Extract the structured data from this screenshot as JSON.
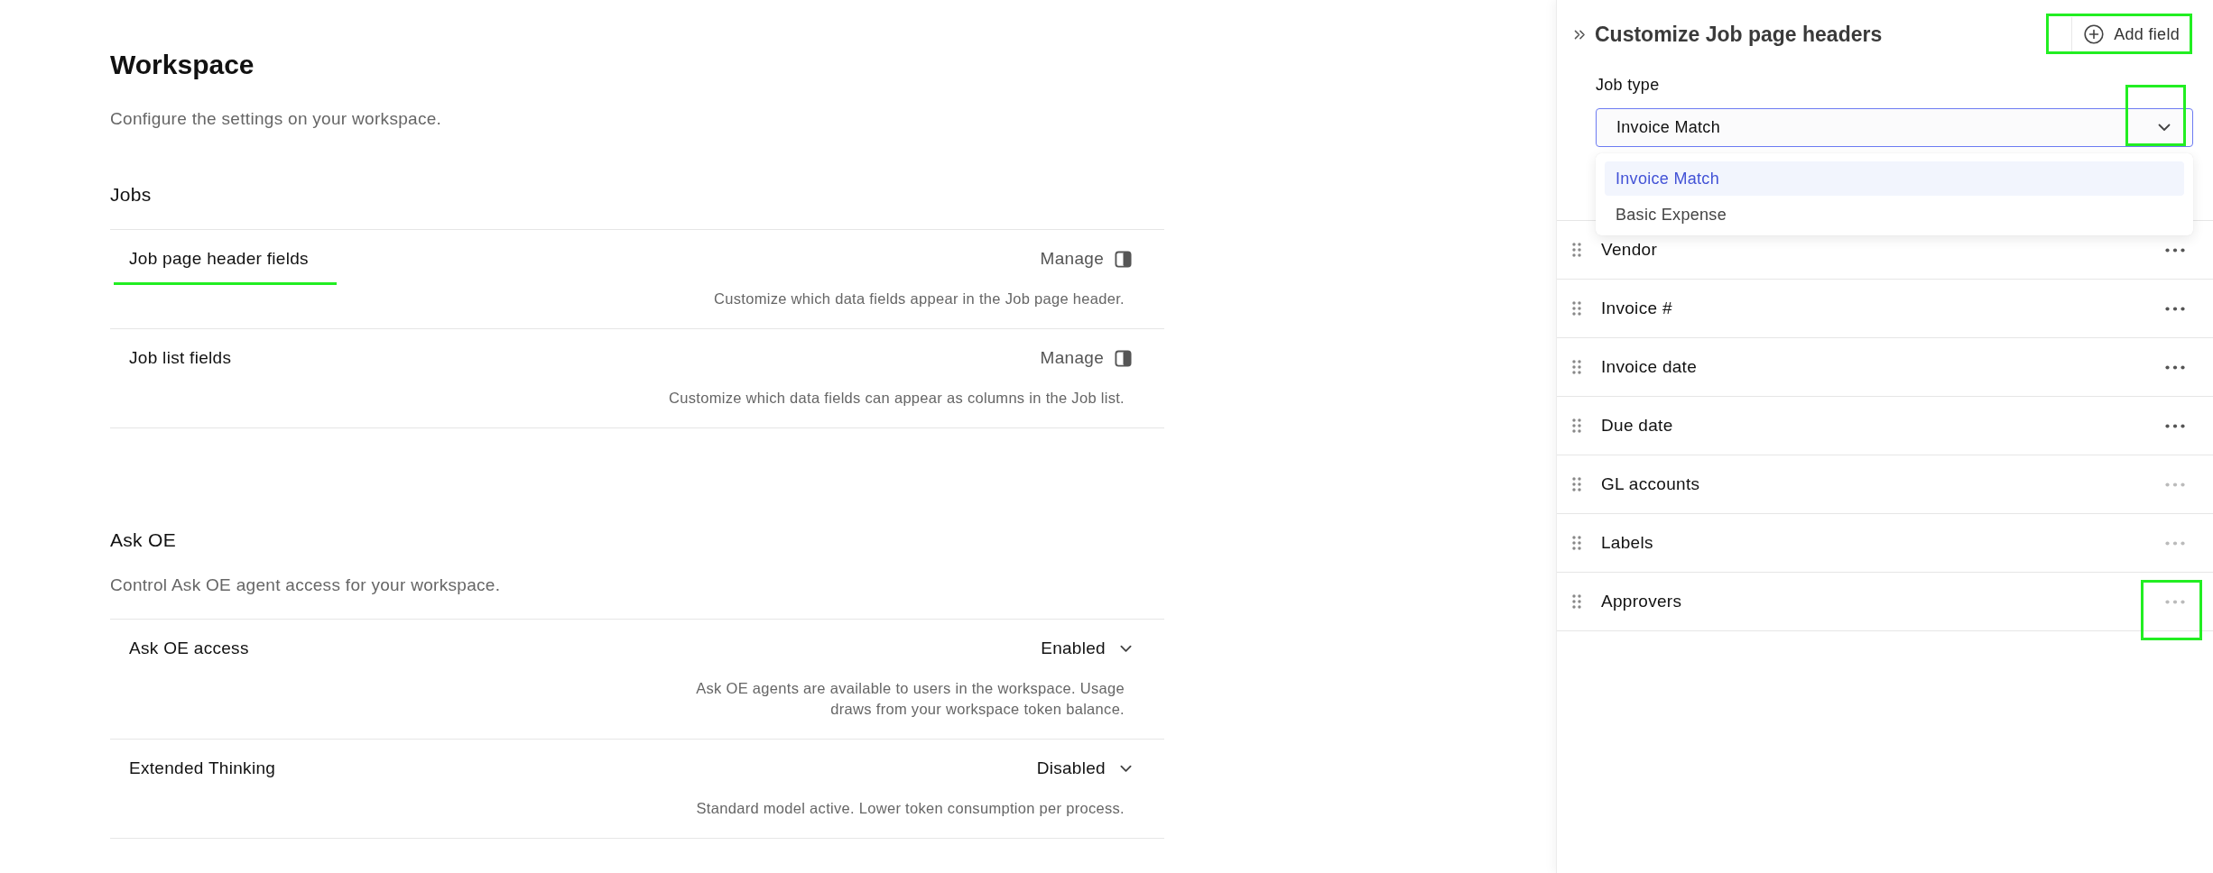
{
  "page": {
    "title": "Workspace",
    "description": "Configure the settings on your workspace."
  },
  "sections": [
    {
      "title": "Jobs",
      "rows": [
        {
          "kind": "manage",
          "label": "Job page header fields",
          "action": "Manage",
          "description": "Customize which data fields appear in the Job page header.",
          "highlighted": true
        },
        {
          "kind": "manage",
          "label": "Job list fields",
          "action": "Manage",
          "description": "Customize which data fields can appear as columns in the Job list.",
          "highlighted": false
        }
      ]
    },
    {
      "title": "Ask OE",
      "description": "Control Ask OE agent access for your workspace.",
      "rows": [
        {
          "kind": "select",
          "label": "Ask OE access",
          "value": "Enabled",
          "description": "Ask OE agents are available to users in the workspace. Usage draws from your workspace token balance.",
          "highlighted": false
        },
        {
          "kind": "select",
          "label": "Extended Thinking",
          "value": "Disabled",
          "description": "Standard model active. Lower token consumption per process.",
          "highlighted": false
        }
      ]
    }
  ],
  "panel": {
    "title": "Customize Job page headers",
    "add_button": {
      "label": "Add field",
      "highlighted": true
    },
    "job_type": {
      "label": "Job type",
      "value": "Invoice Match",
      "expanded": true,
      "chevron_highlighted": true,
      "options": [
        {
          "label": "Invoice Match",
          "selected": true
        },
        {
          "label": "Basic Expense",
          "selected": false
        }
      ]
    },
    "fields": [
      {
        "label": "Vendor",
        "menu_disabled": false,
        "menu_highlighted": false
      },
      {
        "label": "Invoice #",
        "menu_disabled": false,
        "menu_highlighted": false
      },
      {
        "label": "Invoice date",
        "menu_disabled": false,
        "menu_highlighted": false
      },
      {
        "label": "Due date",
        "menu_disabled": false,
        "menu_highlighted": false
      },
      {
        "label": "GL accounts",
        "menu_disabled": true,
        "menu_highlighted": false
      },
      {
        "label": "Labels",
        "menu_disabled": true,
        "menu_highlighted": false
      },
      {
        "label": "Approvers",
        "menu_disabled": true,
        "menu_highlighted": true
      }
    ]
  }
}
